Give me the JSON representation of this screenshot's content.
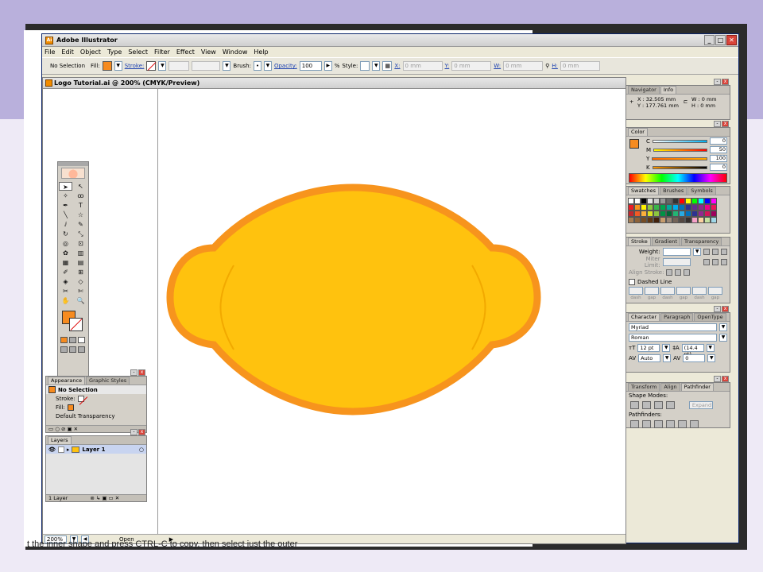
{
  "app": {
    "title": "Adobe Illustrator",
    "window_buttons": [
      "_",
      "□",
      "✕"
    ]
  },
  "menu": [
    "File",
    "Edit",
    "Object",
    "Type",
    "Select",
    "Filter",
    "Effect",
    "View",
    "Window",
    "Help"
  ],
  "control_bar": {
    "selection": "No Selection",
    "fill_label": "Fill:",
    "stroke_label": "Stroke:",
    "brush_label": "Brush:",
    "opacity_label": "Opacity:",
    "opacity_value": "100",
    "opacity_unit": "%",
    "style_label": "Style:",
    "x_label": "X:",
    "x_value": "0 mm",
    "y_label": "Y:",
    "y_value": "0 mm",
    "w_label": "W:",
    "w_value": "0 mm",
    "h_label": "H:",
    "h_value": "0 mm"
  },
  "document": {
    "title": "Logo Tutorial.ai @ 200% (CMYK/Preview)",
    "zoom": "200%",
    "status": "Open"
  },
  "info_panel": {
    "tabs": [
      "Navigator",
      "Info"
    ],
    "x": "X : 32.505 mm",
    "y": "Y : 177.761 mm",
    "w": "W : 0 mm",
    "h": "H : 0 mm"
  },
  "color_panel": {
    "tab": "Color",
    "channels": [
      {
        "label": "C",
        "value": "0"
      },
      {
        "label": "M",
        "value": "50"
      },
      {
        "label": "Y",
        "value": "100"
      },
      {
        "label": "K",
        "value": "0"
      }
    ]
  },
  "swatches_panel": {
    "tabs": [
      "Swatches",
      "Brushes",
      "Symbols"
    ]
  },
  "stroke_panel": {
    "tabs": [
      "Stroke",
      "Gradient",
      "Transparency"
    ],
    "weight_label": "Weight:",
    "miter_label": "Miter Limit:",
    "align_label": "Align Stroke:",
    "dashed_label": "Dashed Line",
    "dash_labels": [
      "dash",
      "gap",
      "dash",
      "gap",
      "dash",
      "gap"
    ]
  },
  "character_panel": {
    "tabs": [
      "Character",
      "Paragraph",
      "OpenType"
    ],
    "font": "Myriad",
    "style": "Roman",
    "size": "12 pt",
    "leading": "(14.4 pt)",
    "kerning": "Auto",
    "tracking": "0"
  },
  "pathfinder_panel": {
    "tabs": [
      "Transform",
      "Align",
      "Pathfinder"
    ],
    "shape_modes_label": "Shape Modes:",
    "expand_label": "Expand",
    "pathfinders_label": "Pathfinders:"
  },
  "appearance_panel": {
    "tabs": [
      "Appearance",
      "Graphic Styles"
    ],
    "header": "No Selection",
    "stroke_label": "Stroke:",
    "fill_label": "Fill:",
    "transparency": "Default Transparency"
  },
  "layers_panel": {
    "tab": "Layers",
    "layer_name": "Layer 1",
    "footer": "1 Layer"
  },
  "slide": {
    "caption": "t the inner shape and press CTRL-C to copy, then select just the outer"
  },
  "colors": {
    "fill_orange": "#f68b1f",
    "lemon_fill": "#ffc20e",
    "lemon_stroke": "#f7941d"
  }
}
